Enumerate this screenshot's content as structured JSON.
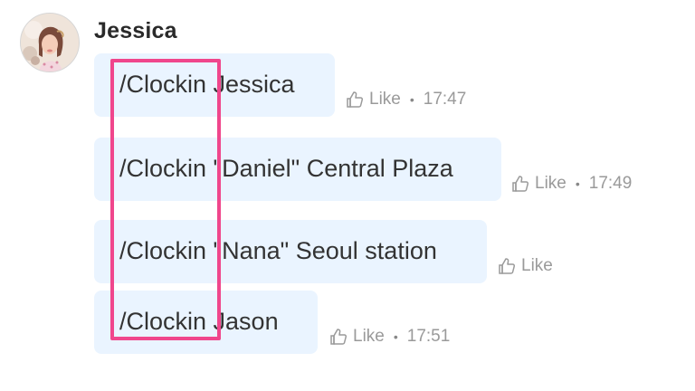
{
  "sender": {
    "name": "Jessica"
  },
  "messages": [
    {
      "text": "/Clockin Jessica",
      "like_label": "Like",
      "time": "17:47"
    },
    {
      "text": "/Clockin \"Daniel\" Central Plaza",
      "like_label": "Like",
      "time": "17:49"
    },
    {
      "text": "/Clockin \"Nana\" Seoul station",
      "like_label": "Like",
      "time": ""
    },
    {
      "text": "/Clockin Jason",
      "like_label": "Like",
      "time": "17:51"
    }
  ],
  "icons": {
    "like": "thumbs-up-icon",
    "avatar": "profile-photo"
  },
  "colors": {
    "bubble_background": "#eaf4ff",
    "highlight": "#f0468c",
    "meta_text": "#9a9a9a"
  }
}
